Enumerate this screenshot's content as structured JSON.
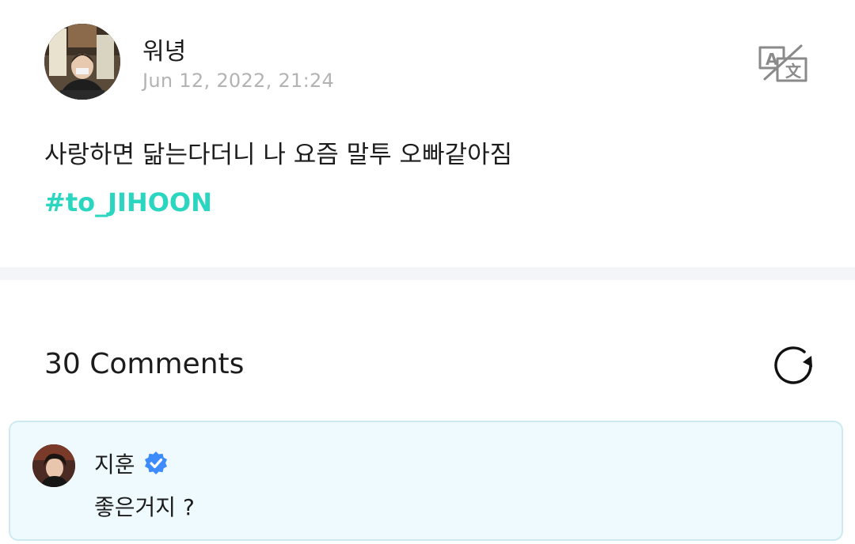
{
  "post": {
    "author": "워녕",
    "date": "Jun 12, 2022, 21:24",
    "text": "사랑하면 닮는다더니 나 요즘 말투 오빠같아짐",
    "hashtag": "#to_JIHOON",
    "translate_icon": "translate-icon"
  },
  "comments": {
    "count_label": "30 Comments",
    "refresh_icon": "refresh-icon",
    "items": [
      {
        "author": "지훈",
        "verified": true,
        "text": "좋은거지 ?"
      }
    ]
  },
  "colors": {
    "hashtag": "#2bd6c0",
    "date": "#b3b3b3",
    "verified_badge": "#3d8bfd",
    "highlight_bg": "#eefafd",
    "highlight_border": "#cdeaf0",
    "divider": "#f4f5f8"
  }
}
